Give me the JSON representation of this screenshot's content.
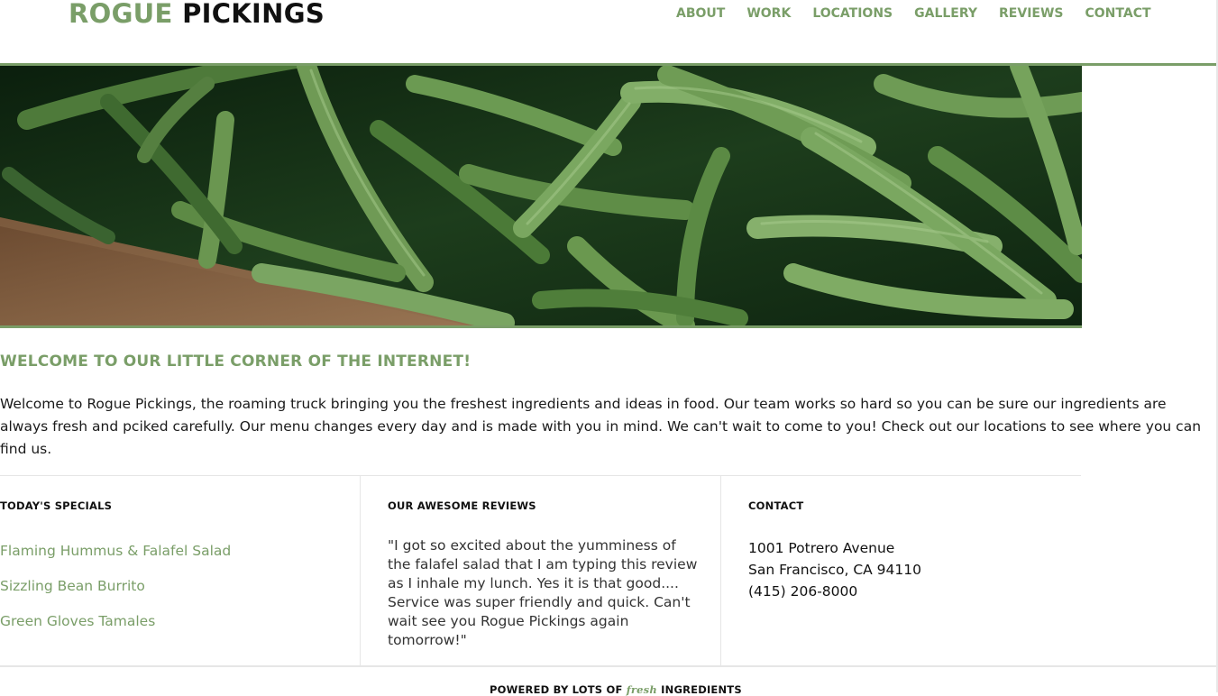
{
  "brand": {
    "name_part1": "ROGUE",
    "name_part2": "PICKINGS",
    "accent_color": "#7a9e68"
  },
  "nav": {
    "items": [
      {
        "label": "ABOUT"
      },
      {
        "label": "WORK"
      },
      {
        "label": "LOCATIONS"
      },
      {
        "label": "GALLERY"
      },
      {
        "label": "REVIEWS"
      },
      {
        "label": "CONTACT"
      }
    ]
  },
  "hero": {
    "image_subject": "green-beans-photo"
  },
  "welcome": {
    "title": "WELCOME TO OUR LITTLE CORNER OF THE INTERNET!",
    "body": "Welcome to Rogue Pickings, the roaming truck bringing you the freshest ingredients and ideas in food. Our team works so hard so you can be sure our ingredients are always fresh and pciked carefully. Our menu changes every day and is made with you in mind. We can't wait to come to you! Check out our locations to see where you can find us."
  },
  "specials": {
    "title": "TODAY'S SPECIALS",
    "items": [
      {
        "label": "Flaming Hummus & Falafel Salad"
      },
      {
        "label": "Sizzling Bean Burrito"
      },
      {
        "label": "Green Gloves Tamales"
      }
    ]
  },
  "reviews": {
    "title": "OUR AWESOME REVIEWS",
    "quote": "\"I got so excited about the yumminess of the falafel salad that I am typing this review as I inhale my lunch. Yes it is that good.... Service was super friendly and quick. Can't wait see you Rogue Pickings again tomorrow!\""
  },
  "contact": {
    "title": "CONTACT",
    "address_line1": "1001 Potrero Avenue",
    "address_line2": "San Francisco, CA 94110",
    "phone": "(415) 206-8000"
  },
  "footer": {
    "prefix": "POWERED BY LOTS OF",
    "fresh": "fresh",
    "suffix": "INGREDIENTS"
  }
}
